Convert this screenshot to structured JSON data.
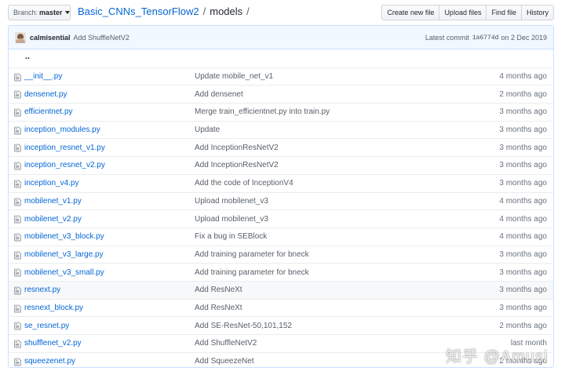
{
  "toolbar": {
    "branch_label": "Branch:",
    "branch_value": "master",
    "repo": "Basic_CNNs_TensorFlow2",
    "separator": "/",
    "folder": "models",
    "trailing_separator": "/",
    "buttons": [
      "Create new file",
      "Upload files",
      "Find file",
      "History"
    ]
  },
  "commit": {
    "author": "calmisential",
    "message": "Add ShuffleNetV2",
    "latest_label": "Latest commit",
    "sha": "1a6774d",
    "date": "on 2 Dec 2019"
  },
  "parent_dir": "..",
  "files": [
    {
      "name": "__init__.py",
      "message": "Update mobile_net_v1",
      "age": "4 months ago"
    },
    {
      "name": "densenet.py",
      "message": "Add densenet",
      "age": "2 months ago"
    },
    {
      "name": "efficientnet.py",
      "message": "Merge train_efficientnet.py into train.py",
      "age": "3 months ago"
    },
    {
      "name": "inception_modules.py",
      "message": "Update",
      "age": "3 months ago"
    },
    {
      "name": "inception_resnet_v1.py",
      "message": "Add InceptionResNetV2",
      "age": "3 months ago"
    },
    {
      "name": "inception_resnet_v2.py",
      "message": "Add InceptionResNetV2",
      "age": "3 months ago"
    },
    {
      "name": "inception_v4.py",
      "message": "Add the code of InceptionV4",
      "age": "3 months ago"
    },
    {
      "name": "mobilenet_v1.py",
      "message": "Upload mobilenet_v3",
      "age": "4 months ago"
    },
    {
      "name": "mobilenet_v2.py",
      "message": "Upload mobilenet_v3",
      "age": "4 months ago"
    },
    {
      "name": "mobilenet_v3_block.py",
      "message": "Fix a bug in SEBlock",
      "age": "4 months ago"
    },
    {
      "name": "mobilenet_v3_large.py",
      "message": "Add training parameter for bneck",
      "age": "3 months ago"
    },
    {
      "name": "mobilenet_v3_small.py",
      "message": "Add training parameter for bneck",
      "age": "3 months ago"
    },
    {
      "name": "resnext.py",
      "message": "Add ResNeXt",
      "age": "3 months ago"
    },
    {
      "name": "resnext_block.py",
      "message": "Add ResNeXt",
      "age": "3 months ago"
    },
    {
      "name": "se_resnet.py",
      "message": "Add SE-ResNet-50,101,152",
      "age": "2 months ago"
    },
    {
      "name": "shufflenet_v2.py",
      "message": "Add ShuffleNetV2",
      "age": "last month"
    },
    {
      "name": "squeezenet.py",
      "message": "Add SqueezeNet",
      "age": "2 months ago"
    }
  ],
  "watermark": "知乎 @Amusi",
  "colors": {
    "link": "#0366d6",
    "commit_bar": "#f1f8ff",
    "hover_row": "#f6f8fa"
  }
}
